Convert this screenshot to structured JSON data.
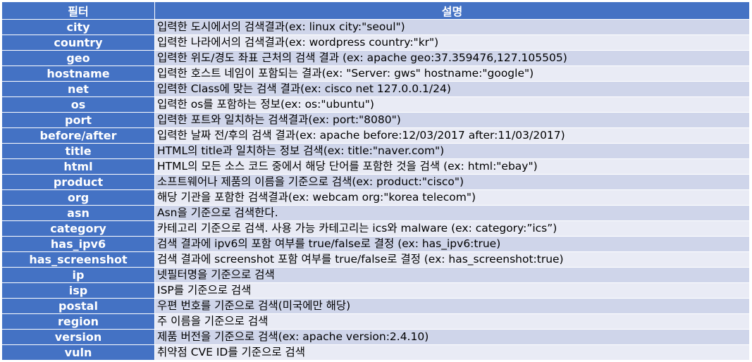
{
  "header": {
    "filter": "필터",
    "description": "설명"
  },
  "rows": [
    {
      "filter": "city",
      "description": "입력한 도시에서의 검색결과(ex: linux city:\"seoul\")"
    },
    {
      "filter": "country",
      "description": "입력한 나라에서의 검색결과(ex: wordpress country:\"kr\")"
    },
    {
      "filter": "geo",
      "description": "입력한 위도/경도 좌표 근처의 검색 결과 (ex: apache geo:37.359476,127.105505)"
    },
    {
      "filter": "hostname",
      "description": "입력한 호스트 네임이 포함되는 결과(ex: \"Server: gws\" hostname:\"google\")"
    },
    {
      "filter": "net",
      "description": "입력한 Class에 맞는 검색 결과(ex: cisco net 127.0.0.1/24)"
    },
    {
      "filter": "os",
      "description": "입력한 os를 포함하는 정보(ex: os:\"ubuntu\")"
    },
    {
      "filter": "port",
      "description": "입력한 포트와 일치하는 검색결과(ex: port:\"8080\")"
    },
    {
      "filter": "before/after",
      "description": "입력한 날짜 전/후의 검색 결과(ex: apache before:12/03/2017  after:11/03/2017)"
    },
    {
      "filter": "title",
      "description": "HTML의 title과 일치하는 정보 검색(ex: title:\"naver.com\")"
    },
    {
      "filter": "html",
      "description": "HTML의 모든 소스 코드 중에서 해당 단어를 포함한 것을 검색 (ex: html:\"ebay\")"
    },
    {
      "filter": "product",
      "description": "소프트웨어나 제품의 이름을 기준으로 검색(ex: product:\"cisco\")"
    },
    {
      "filter": "org",
      "description": "해당 기관을 포함한 검색결과(ex: webcam org:\"korea telecom\")"
    },
    {
      "filter": "asn",
      "description": "Asn을 기준으로 검색한다."
    },
    {
      "filter": "category",
      "description": "카테고리 기준으로 검색. 사용 가능 카테고리는 ics와 malware (ex: category:”ics”)"
    },
    {
      "filter": "has_ipv6",
      "description": "검색 결과에 ipv6의 포함 여부를 true/false로 결정 (ex: has_ipv6:true)"
    },
    {
      "filter": "has_screenshot",
      "description": "검색 결과에 screenshot 포함 여부를 true/false로 결정 (ex: has_screenshot:true)"
    },
    {
      "filter": "ip",
      "description": "넷필터명을 기준으로 검색"
    },
    {
      "filter": "isp",
      "description": "ISP를 기준으로 검색"
    },
    {
      "filter": "postal",
      "description": "우편 번호를 기준으로 검색(미국에만 해당)"
    },
    {
      "filter": "region",
      "description": "주 이름을 기준으로 검색"
    },
    {
      "filter": "version",
      "description": "제품 버전을 기준으로 검색(ex: apache version:2.4.10)"
    },
    {
      "filter": "vuln",
      "description": "취약점 CVE ID를 기준으로 검색"
    }
  ]
}
